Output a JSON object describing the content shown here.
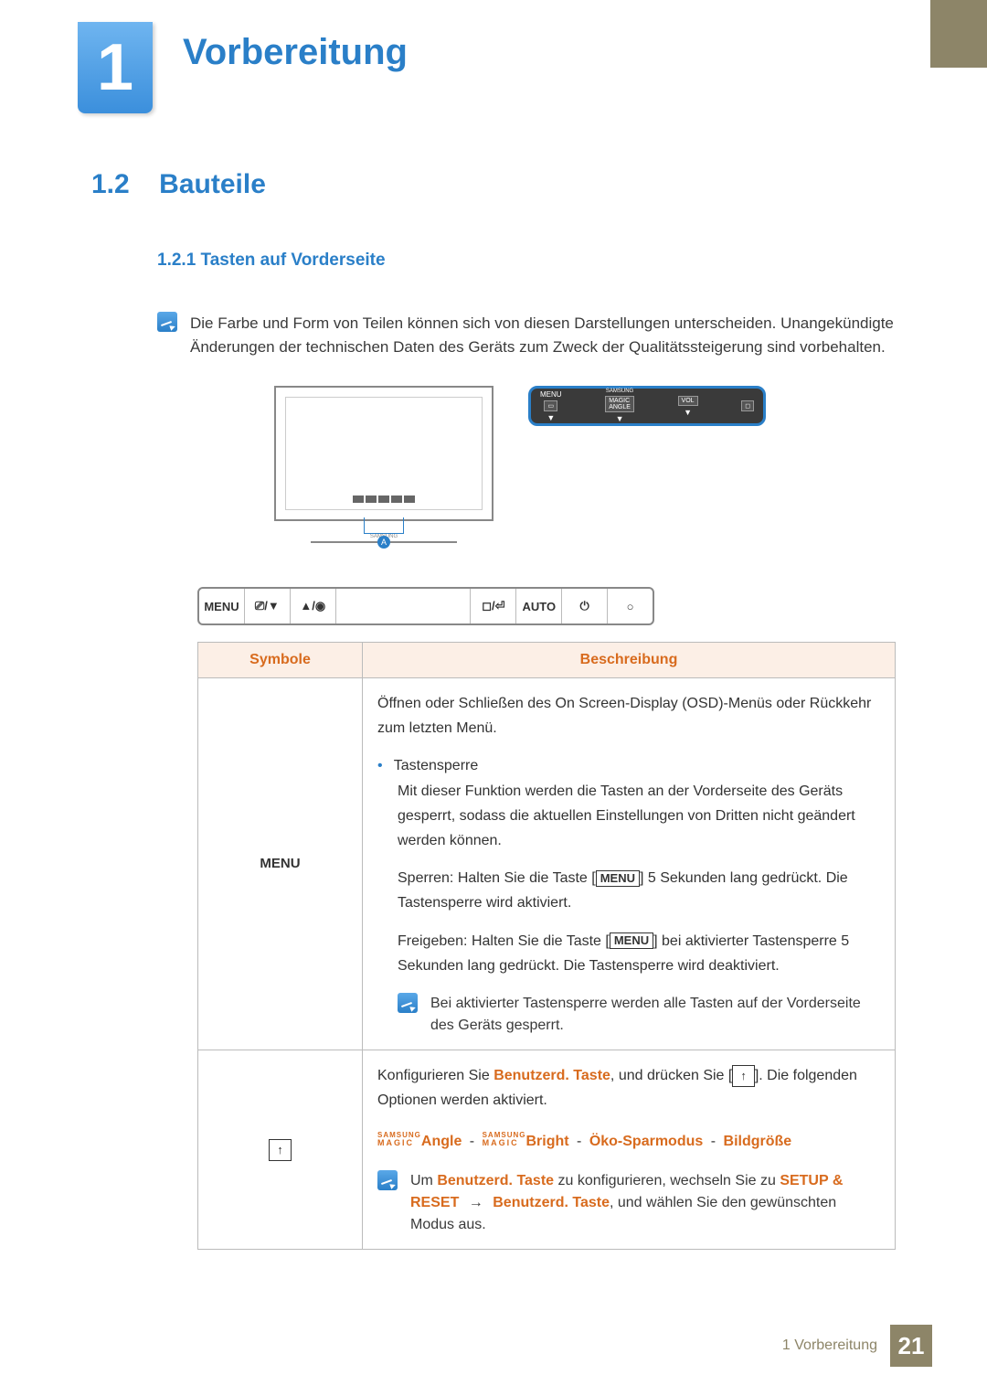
{
  "chapter": {
    "number": "1",
    "title": "Vorbereitung"
  },
  "section": {
    "number": "1.2",
    "title": "Bauteile"
  },
  "subsection": {
    "number": "1.2.1",
    "title": "Tasten auf Vorderseite"
  },
  "intro_note": "Die Farbe und Form von Teilen können sich von diesen Darstellungen unterscheiden. Unangekündigte Änderungen der technischen Daten des Geräts zum Zweck der Qualitätssteigerung sind vorbehalten.",
  "diagram": {
    "marker": "A",
    "brand": "SAMSUNG",
    "panel": {
      "menu": "MENU",
      "magic_top": "SAMSUNG",
      "magic_mid": "MAGIC",
      "magic_bot": "ANGLE",
      "vol": "VOL"
    }
  },
  "button_strip": {
    "b1": "MENU",
    "b2": "⎚/▼",
    "b3": "▲/◉",
    "b4": "",
    "b5": "◻/⏎",
    "b6": "AUTO",
    "b7": "⏻",
    "b8": "○"
  },
  "table": {
    "headers": {
      "symbol": "Symbole",
      "description": "Beschreibung"
    },
    "row1": {
      "symbol": "MENU",
      "desc1": "Öffnen oder Schließen des On Screen-Display (OSD)-Menüs oder Rückkehr zum letzten Menü.",
      "bullet_title": "Tastensperre",
      "desc2": "Mit dieser Funktion werden die Tasten an der Vorderseite des Geräts gesperrt, sodass die aktuellen Einstellungen von Dritten nicht geändert werden können.",
      "desc3a": "Sperren: Halten Sie die Taste [",
      "desc3b": "] 5 Sekunden lang gedrückt. Die Tastensperre wird aktiviert.",
      "desc4a": "Freigeben: Halten Sie die Taste [",
      "desc4b": "] bei aktivierter Tastensperre 5 Sekunden lang gedrückt. Die Tastensperre wird deaktiviert.",
      "note": "Bei aktivierter Tastensperre werden alle Tasten auf der Vorderseite des Geräts gesperrt.",
      "menu_key": "MENU"
    },
    "row2": {
      "symbol": "↑",
      "desc1a": "Konfigurieren Sie ",
      "desc1_orange": "Benutzerd. Taste",
      "desc1b": ", und drücken Sie [",
      "desc1c": "]. Die folgenden Optionen werden aktiviert.",
      "magic_small_top": "SAMSUNG",
      "magic_small_bot": "MAGIC",
      "opt_angle": "Angle",
      "opt_bright": "Bright",
      "opt_eco": "Öko-Sparmodus",
      "opt_size": "Bildgröße",
      "sep": "-",
      "note1a": "Um ",
      "note1_orange1": "Benutzerd. Taste",
      "note1b": " zu konfigurieren, wechseln Sie zu ",
      "note1_orange2": "SETUP & RESET",
      "note1_arrow": "→",
      "note1_orange3": "Benutzerd. Taste",
      "note1c": ", und wählen Sie den gewünschten Modus aus."
    }
  },
  "footer": {
    "text": "1 Vorbereitung",
    "page": "21"
  }
}
